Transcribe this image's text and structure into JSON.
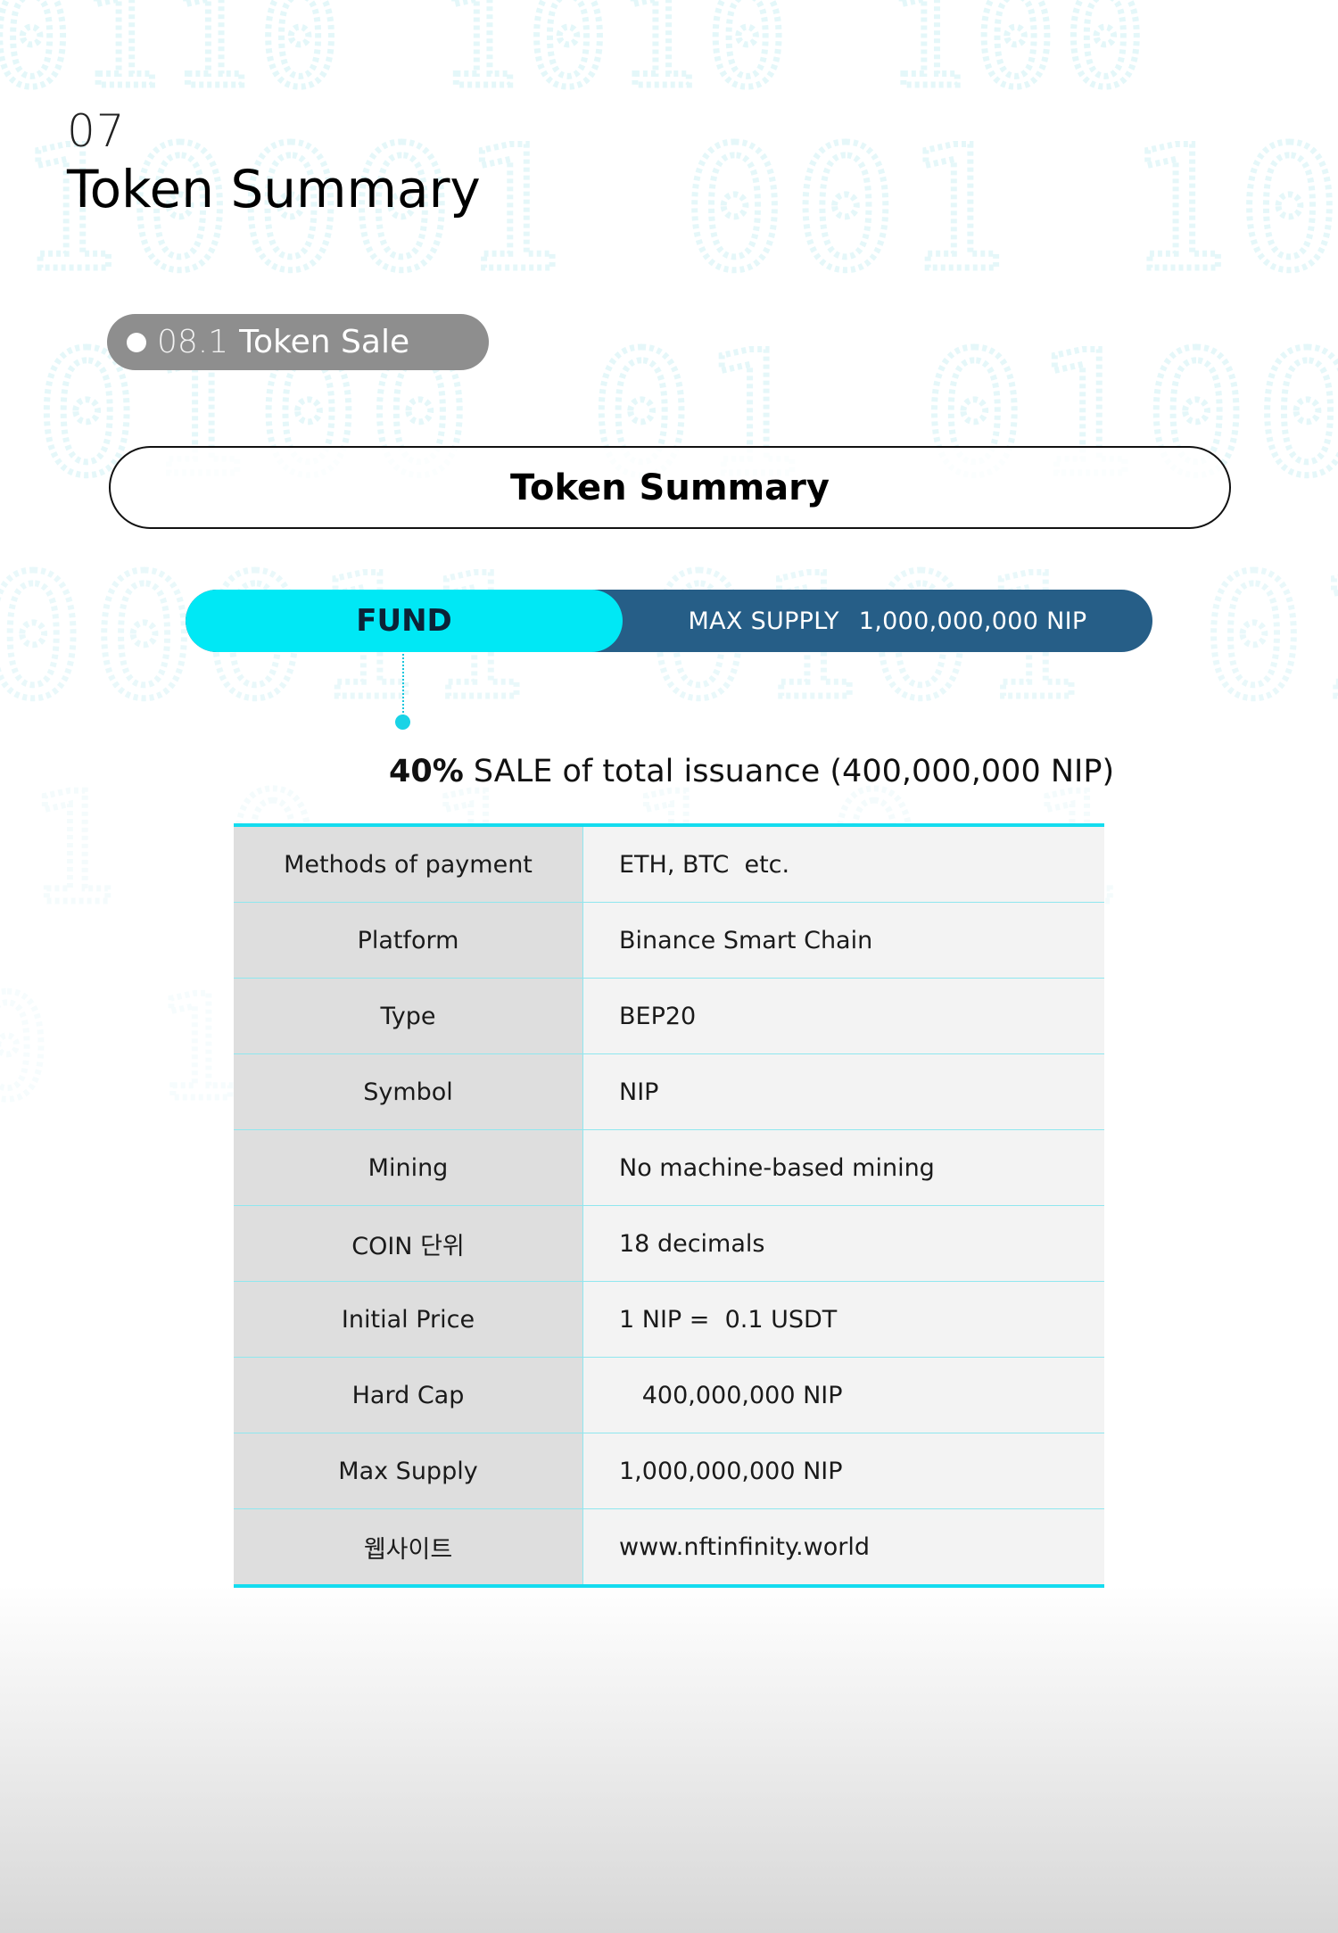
{
  "header": {
    "section_number": "07",
    "title": "Token Summary"
  },
  "subsection": {
    "number": "08.1",
    "label": "Token Sale"
  },
  "banner": {
    "title": "Token Summary"
  },
  "fund_bar": {
    "fund_label": "FUND",
    "max_supply_label": "MAX SUPPLY",
    "max_supply_value": "1,000,000,000 NIP"
  },
  "sale": {
    "percent": "40%",
    "text": "SALE of total issuance (400,000,000 NIP)"
  },
  "table": {
    "rows": [
      {
        "key": "Methods of payment",
        "value": "ETH, BTC  etc."
      },
      {
        "key": "Platform",
        "value": "Binance Smart Chain"
      },
      {
        "key": "Type",
        "value": "BEP20"
      },
      {
        "key": "Symbol",
        "value": "NIP"
      },
      {
        "key": "Mining",
        "value": "No machine-based mining"
      },
      {
        "key": "COIN 단위",
        "value": "18 decimals"
      },
      {
        "key": "Initial Price",
        "value": "1 NIP =  0.1 USDT"
      },
      {
        "key": "Hard Cap",
        "value": "   400,000,000 NIP"
      },
      {
        "key": "Max Supply",
        "value": "1,000,000,000 NIP"
      },
      {
        "key": "웹사이트",
        "value": "www.nftinfinity.world"
      }
    ]
  },
  "colors": {
    "accent_cyan": "#00e8f5",
    "navy": "#265e87",
    "pill_gray": "#8e8e8e"
  }
}
